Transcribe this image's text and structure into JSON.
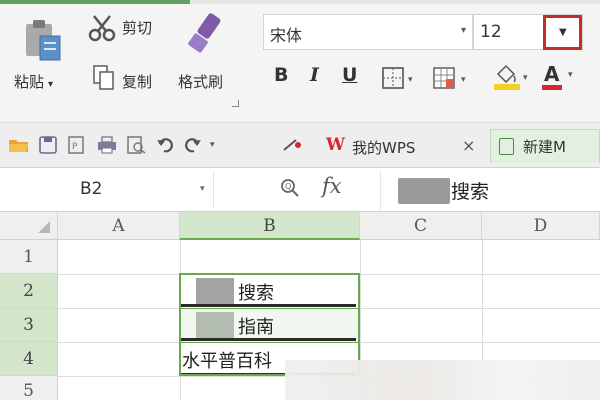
{
  "ribbon": {
    "paste_label": "粘贴",
    "cut_label": "剪切",
    "copy_label": "复制",
    "format_painter_label": "格式刷",
    "font_name": "宋体",
    "font_size": "12",
    "bold": "B",
    "italic": "I",
    "underline": "U",
    "font_color_label": "A"
  },
  "quickbar": {
    "tab_wps_label": "我的WPS",
    "tab_close": "×",
    "tab_new_label": "新建M",
    "wps_logo": "W"
  },
  "formula_bar": {
    "cell_ref": "B2",
    "fx_label": "fx",
    "value": "搜索"
  },
  "grid": {
    "columns": [
      "A",
      "B",
      "C",
      "D"
    ],
    "rows": [
      "1",
      "2",
      "3",
      "4",
      "5"
    ],
    "cells": {
      "b2": "搜索",
      "b3": "指南",
      "b4": "水平普百科"
    }
  }
}
